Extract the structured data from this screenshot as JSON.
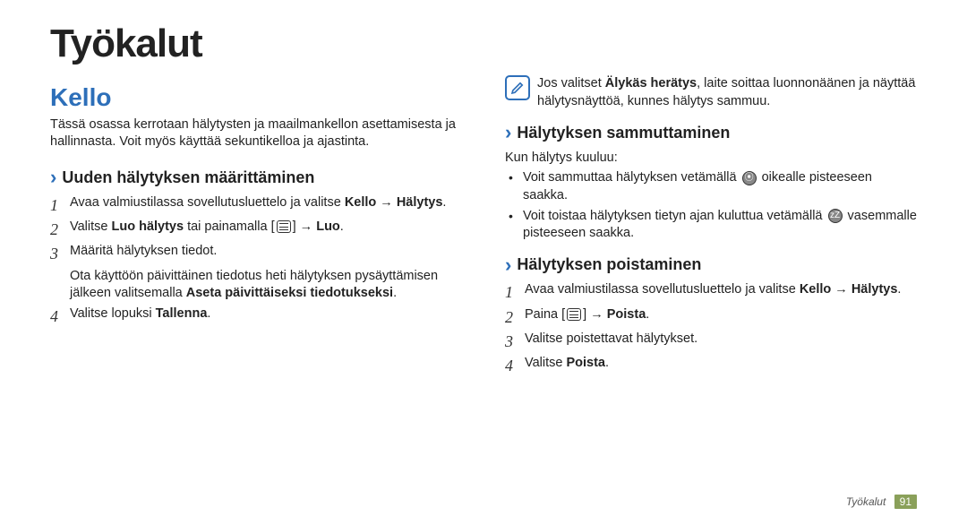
{
  "title": "Työkalut",
  "section": "Kello",
  "intro": "Tässä osassa kerrotaan hälytysten ja maailmankellon asettamisesta ja hallinnasta. Voit myös käyttää sekuntikelloa ja ajastinta.",
  "left": {
    "sub1": "Uuden hälytyksen määrittäminen",
    "step1_a": "Avaa valmiustilassa sovellutusluettelo ja valitse ",
    "step1_b": "Kello",
    "step1_c": " → ",
    "step1_d": "Hälytys",
    "step1_e": ".",
    "step2_a": "Valitse ",
    "step2_b": "Luo hälytys",
    "step2_c": " tai painamalla [",
    "step2_d": "] → ",
    "step2_e": "Luo",
    "step2_f": ".",
    "step3": "Määritä hälytyksen tiedot.",
    "step3_note_a": "Ota käyttöön päivittäinen tiedotus heti hälytyksen pysäyttämisen jälkeen valitsemalla ",
    "step3_note_b": "Aseta päivittäiseksi tiedotukseksi",
    "step3_note_c": ".",
    "step4_a": "Valitse lopuksi ",
    "step4_b": "Tallenna",
    "step4_c": "."
  },
  "right": {
    "note_a": "Jos valitset ",
    "note_b": "Älykäs herätys",
    "note_c": ", laite soittaa luonnonäänen ja näyttää hälytysnäyttöä, kunnes hälytys sammuu.",
    "sub1": "Hälytyksen sammuttaminen",
    "sub1_lead": "Kun hälytys kuuluu:",
    "bul1_a": "Voit sammuttaa hälytyksen vetämällä ",
    "bul1_b": " oikealle pisteeseen saakka.",
    "bul2_a": "Voit toistaa hälytyksen tietyn ajan kuluttua vetämällä ",
    "bul2_b": " vasemmalle pisteeseen saakka.",
    "sub2": "Hälytyksen poistaminen",
    "del1_a": "Avaa valmiustilassa sovellutusluettelo ja valitse ",
    "del1_b": "Kello",
    "del1_c": " → ",
    "del1_d": "Hälytys",
    "del1_e": ".",
    "del2_a": "Paina [",
    "del2_b": "] → ",
    "del2_c": "Poista",
    "del2_d": ".",
    "del3": "Valitse poistettavat hälytykset.",
    "del4_a": "Valitse ",
    "del4_b": "Poista",
    "del4_c": "."
  },
  "footer": {
    "label": "Työkalut",
    "page": "91"
  }
}
